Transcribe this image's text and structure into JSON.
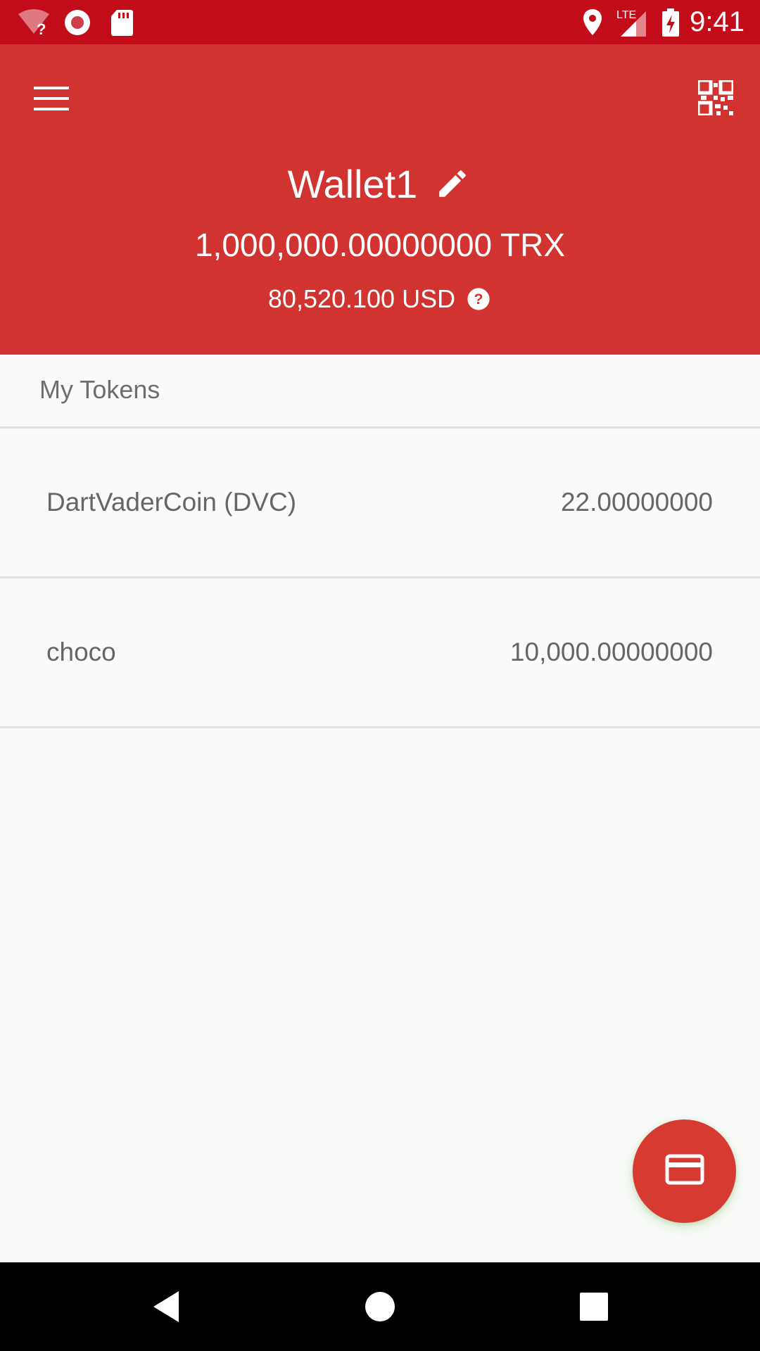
{
  "status_bar": {
    "time": "9:41",
    "network_label": "LTE",
    "icons": [
      "wifi-question-icon",
      "record-icon",
      "sd-card-icon",
      "location-icon",
      "signal-icon",
      "battery-charging-icon"
    ]
  },
  "header": {
    "wallet_name": "Wallet1",
    "trx_balance": "1,000,000.00000000 TRX",
    "usd_balance": "80,520.100 USD",
    "icons": [
      "menu-icon",
      "qr-code-icon",
      "edit-icon",
      "help-icon"
    ]
  },
  "tokens": {
    "section_label": "My Tokens",
    "items": [
      {
        "name": "DartVaderCoin (DVC)",
        "amount": "22.00000000"
      },
      {
        "name": "choco",
        "amount": "10,000.00000000"
      }
    ]
  },
  "fab": {
    "icon": "card-icon"
  },
  "nav": {
    "icons": [
      "back-icon",
      "home-icon",
      "recents-icon"
    ]
  },
  "colors": {
    "status_bar": "#c30c1a",
    "header": "#d13330",
    "fab": "#d63a31",
    "background": "#fafafa"
  }
}
